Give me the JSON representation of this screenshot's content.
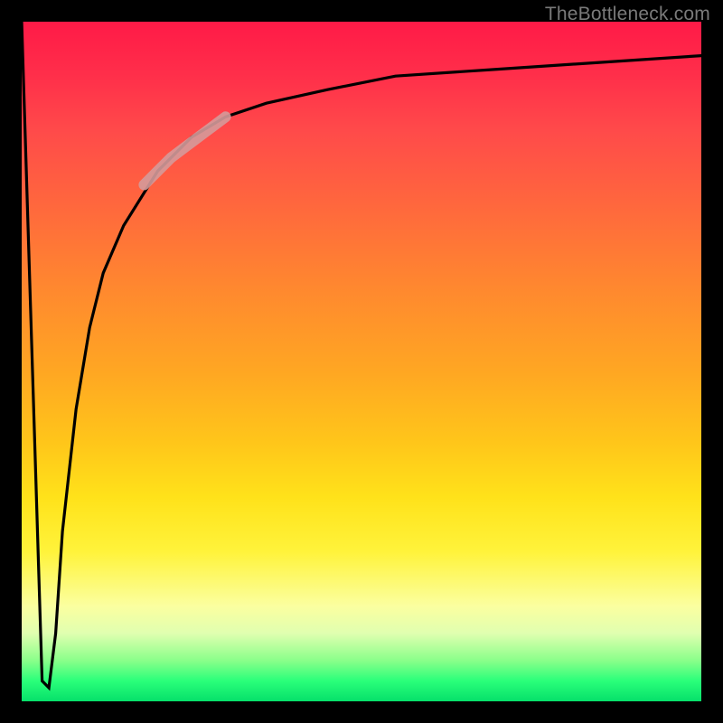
{
  "watermark": "TheBottleneck.com",
  "chart_data": {
    "type": "line",
    "title": "",
    "xlabel": "",
    "ylabel": "",
    "xlim": [
      0,
      100
    ],
    "ylim": [
      0,
      100
    ],
    "grid": false,
    "legend": false,
    "series": [
      {
        "name": "bottleneck-curve",
        "x": [
          0,
          3,
          4,
          5,
          6,
          8,
          10,
          12,
          15,
          20,
          25,
          30,
          36,
          45,
          55,
          70,
          85,
          100
        ],
        "y": [
          100,
          3,
          2,
          10,
          25,
          43,
          55,
          63,
          70,
          78,
          83,
          86,
          88,
          90,
          92,
          93,
          94,
          95
        ]
      },
      {
        "name": "highlight-segment",
        "x": [
          18,
          20,
          22,
          24,
          26,
          28,
          30
        ],
        "y": [
          76,
          78,
          80,
          81.5,
          83,
          84.5,
          86
        ]
      }
    ],
    "annotations": [],
    "colors": {
      "curve": "#000000",
      "highlight": "#d59a9a",
      "gradient_top": "#ff1a47",
      "gradient_mid": "#ffd21a",
      "gradient_bottom": "#06e06a",
      "frame": "#000000"
    }
  }
}
